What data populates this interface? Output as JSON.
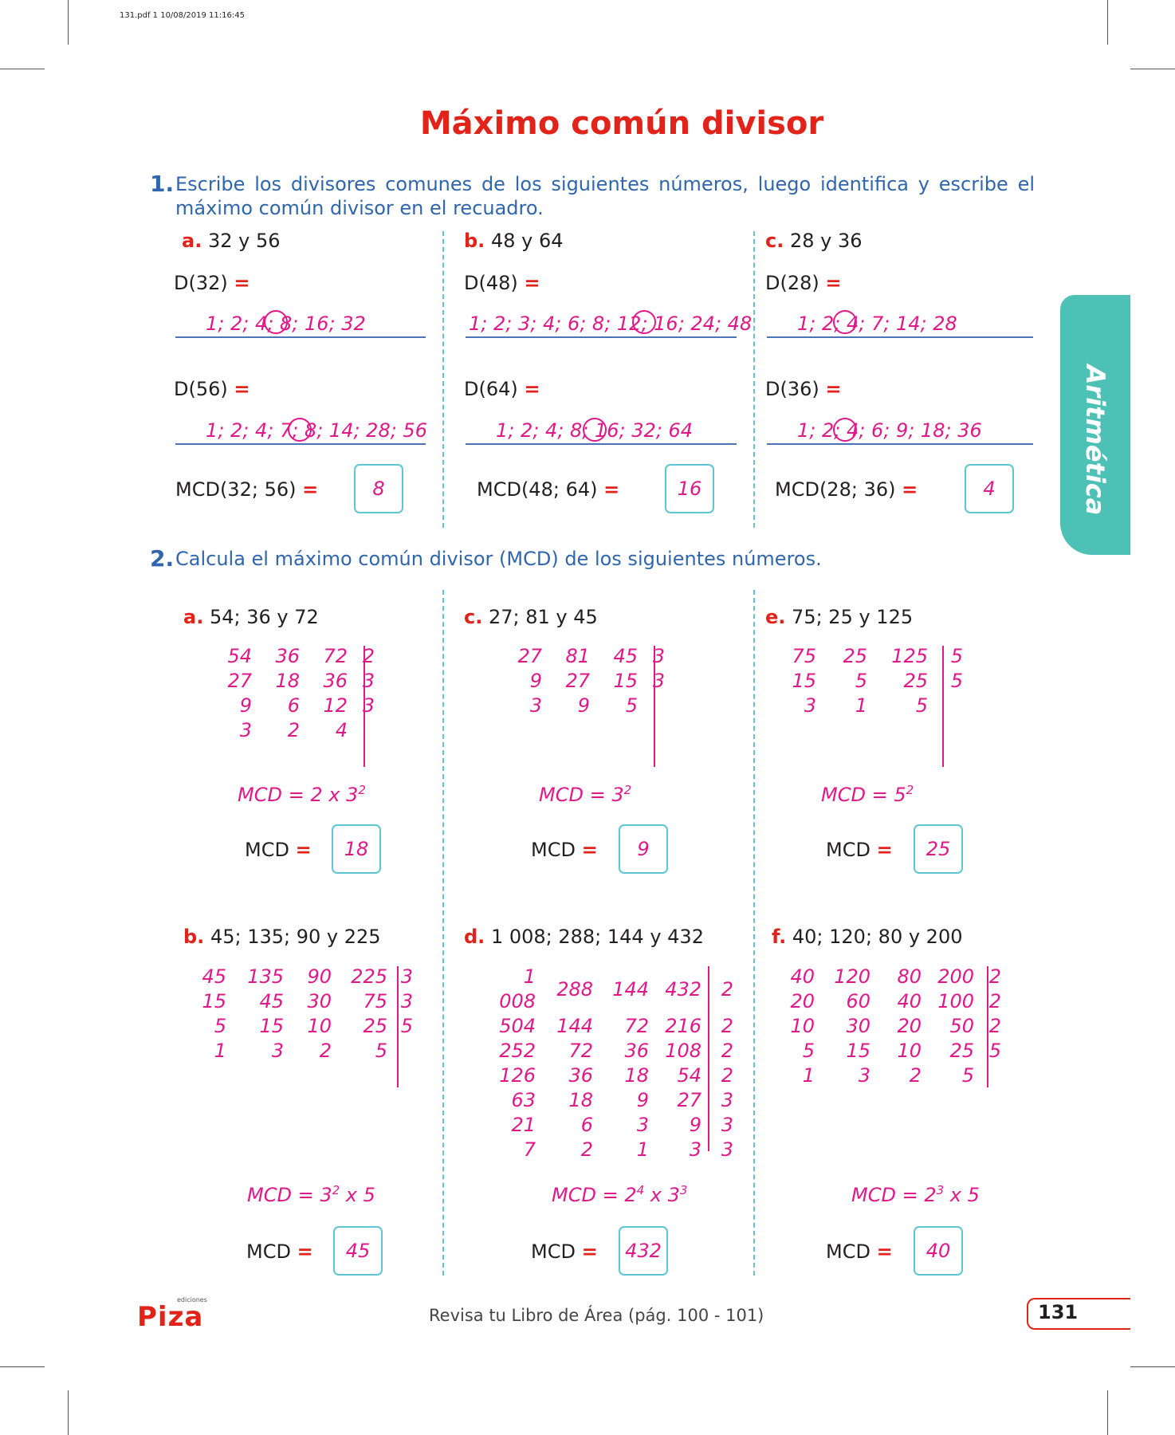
{
  "header_meta": "131.pdf   1   10/08/2019   11:16:45",
  "title": "Máximo común divisor",
  "ex1": {
    "number": "1.",
    "instruction": "Escribe los divisores comunes de los siguientes números, luego identifica y escribe el máximo común divisor en el recuadro.",
    "items": [
      {
        "letter": "a.",
        "pair": "32 y 56",
        "d1_label": "D(32)",
        "d1": "1; 2; 4; 8; 16; 32",
        "d2_label": "D(56)",
        "d2": "1; 2; 4; 7; 8; 14; 28; 56",
        "mcd_label": "MCD(32; 56)",
        "mcd": "8"
      },
      {
        "letter": "b.",
        "pair": "48 y 64",
        "d1_label": "D(48)",
        "d1": "1; 2; 3; 4; 6; 8; 12; 16; 24; 48",
        "d2_label": "D(64)",
        "d2": "1; 2; 4; 8; 16; 32; 64",
        "mcd_label": "MCD(48; 64)",
        "mcd": "16"
      },
      {
        "letter": "c.",
        "pair": "28 y 36",
        "d1_label": "D(28)",
        "d1": "1; 2; 4; 7; 14; 28",
        "d2_label": "D(36)",
        "d2": "1; 2; 4; 6; 9; 18; 36",
        "mcd_label": "MCD(28; 36)",
        "mcd": "4"
      }
    ]
  },
  "ex2": {
    "number": "2.",
    "instruction": "Calcula el máximo común divisor (MCD) de los siguientes números.",
    "mcd_word": "MCD",
    "items": [
      {
        "letter": "a.",
        "numbers": "54; 36 y 72",
        "rows": [
          [
            "54",
            "36",
            "72",
            "2"
          ],
          [
            "27",
            "18",
            "36",
            "3"
          ],
          [
            "9",
            "6",
            "12",
            "3"
          ],
          [
            "3",
            "2",
            "4",
            ""
          ]
        ],
        "formula": "MCD = 2 x 3",
        "formula_exp": "2",
        "formula_tail": "",
        "mcd": "18"
      },
      {
        "letter": "c.",
        "numbers": "27; 81 y 45",
        "rows": [
          [
            "27",
            "81",
            "45",
            "3"
          ],
          [
            "9",
            "27",
            "15",
            "3"
          ],
          [
            "3",
            "9",
            "5",
            ""
          ]
        ],
        "formula": "MCD = 3",
        "formula_exp": "2",
        "formula_tail": "",
        "mcd": "9"
      },
      {
        "letter": "e.",
        "numbers": "75; 25 y 125",
        "rows": [
          [
            "75",
            "25",
            "125",
            "5"
          ],
          [
            "15",
            "5",
            "25",
            "5"
          ],
          [
            "3",
            "1",
            "5",
            ""
          ]
        ],
        "formula": "MCD = 5",
        "formula_exp": "2",
        "formula_tail": "",
        "mcd": "25"
      },
      {
        "letter": "b.",
        "numbers": "45; 135; 90 y 225",
        "rows": [
          [
            "45",
            "135",
            "90",
            "225",
            "3"
          ],
          [
            "15",
            "45",
            "30",
            "75",
            "3"
          ],
          [
            "5",
            "15",
            "10",
            "25",
            "5"
          ],
          [
            "1",
            "3",
            "2",
            "5",
            ""
          ]
        ],
        "formula": "MCD = 3",
        "formula_exp": "2",
        "formula_tail": " x 5",
        "mcd": "45"
      },
      {
        "letter": "d.",
        "numbers": "1 008; 288; 144 y 432",
        "rows": [
          [
            "1 008",
            "288",
            "144",
            "432",
            "2"
          ],
          [
            "504",
            "144",
            "72",
            "216",
            "2"
          ],
          [
            "252",
            "72",
            "36",
            "108",
            "2"
          ],
          [
            "126",
            "36",
            "18",
            "54",
            "2"
          ],
          [
            "63",
            "18",
            "9",
            "27",
            "3"
          ],
          [
            "21",
            "6",
            "3",
            "9",
            "3"
          ],
          [
            "7",
            "2",
            "1",
            "3",
            "3"
          ]
        ],
        "formula": "MCD = 2",
        "formula_exp": "4",
        "formula_tail": " x 3",
        "formula_exp2": "3",
        "mcd": "432"
      },
      {
        "letter": "f.",
        "numbers": "40; 120; 80 y 200",
        "rows": [
          [
            "40",
            "120",
            "80",
            "200",
            "2"
          ],
          [
            "20",
            "60",
            "40",
            "100",
            "2"
          ],
          [
            "10",
            "30",
            "20",
            "50",
            "2"
          ],
          [
            "5",
            "15",
            "10",
            "25",
            "5"
          ],
          [
            "1",
            "3",
            "2",
            "5",
            ""
          ]
        ],
        "formula": "MCD = 2",
        "formula_exp": "3",
        "formula_tail": " x 5",
        "mcd": "40"
      }
    ]
  },
  "side_tab": "Aritmética",
  "footer": {
    "note": "Revisa tu Libro de Área (pág. 100 - 101)",
    "page": "131",
    "logo_text": "Piza",
    "logo_sub": "ediciones"
  },
  "colors": {
    "title_red": "#e2231a",
    "instruction_blue": "#2f66ad",
    "answer_pink": "#e0198a",
    "box_cyan": "#5ec5d3",
    "tab_teal": "#4dc1b5"
  }
}
